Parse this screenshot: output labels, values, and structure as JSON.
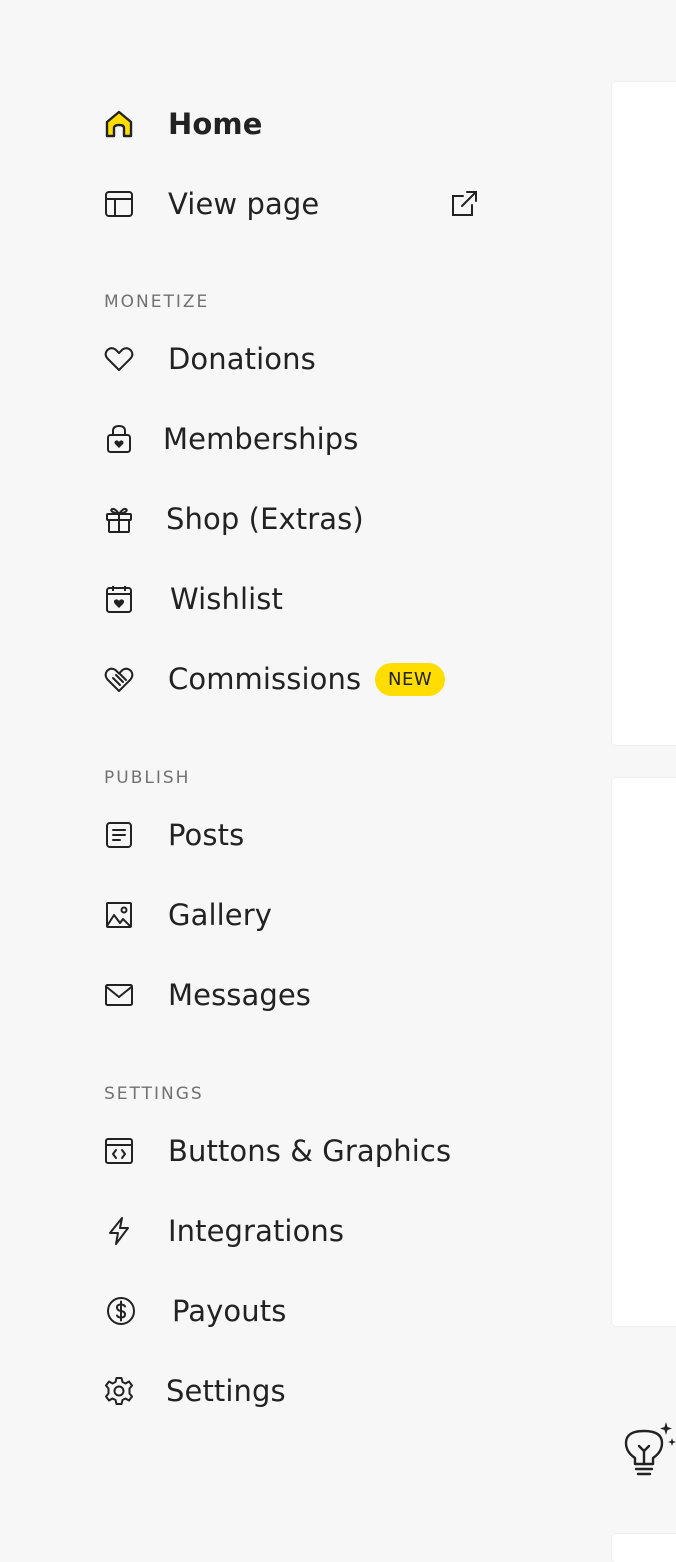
{
  "colors": {
    "accent": "#ffdd00",
    "text": "#222222",
    "section_header": "#717171",
    "background": "#f7f7f7",
    "card": "#ffffff"
  },
  "nav": {
    "home": {
      "label": "Home",
      "icon": "home-icon",
      "active": true
    },
    "view_page": {
      "label": "View page",
      "icon": "layout-icon",
      "trailing_icon": "external-link-icon"
    }
  },
  "sections": {
    "monetize": {
      "title": "MONETIZE",
      "items": [
        {
          "label": "Donations",
          "icon": "heart-icon"
        },
        {
          "label": "Memberships",
          "icon": "lock-heart-icon"
        },
        {
          "label": "Shop (Extras)",
          "icon": "gift-icon"
        },
        {
          "label": "Wishlist",
          "icon": "calendar-heart-icon"
        },
        {
          "label": "Commissions",
          "icon": "handshake-heart-icon",
          "badge": "NEW"
        }
      ]
    },
    "publish": {
      "title": "PUBLISH",
      "items": [
        {
          "label": "Posts",
          "icon": "document-icon"
        },
        {
          "label": "Gallery",
          "icon": "image-icon"
        },
        {
          "label": "Messages",
          "icon": "mail-icon"
        }
      ]
    },
    "settings": {
      "title": "SETTINGS",
      "items": [
        {
          "label": "Buttons & Graphics",
          "icon": "code-window-icon"
        },
        {
          "label": "Integrations",
          "icon": "lightning-icon"
        },
        {
          "label": "Payouts",
          "icon": "dollar-circle-icon"
        },
        {
          "label": "Settings",
          "icon": "gear-icon"
        }
      ]
    }
  },
  "decor": {
    "tip_icon": "lightbulb-sparkle-icon"
  }
}
